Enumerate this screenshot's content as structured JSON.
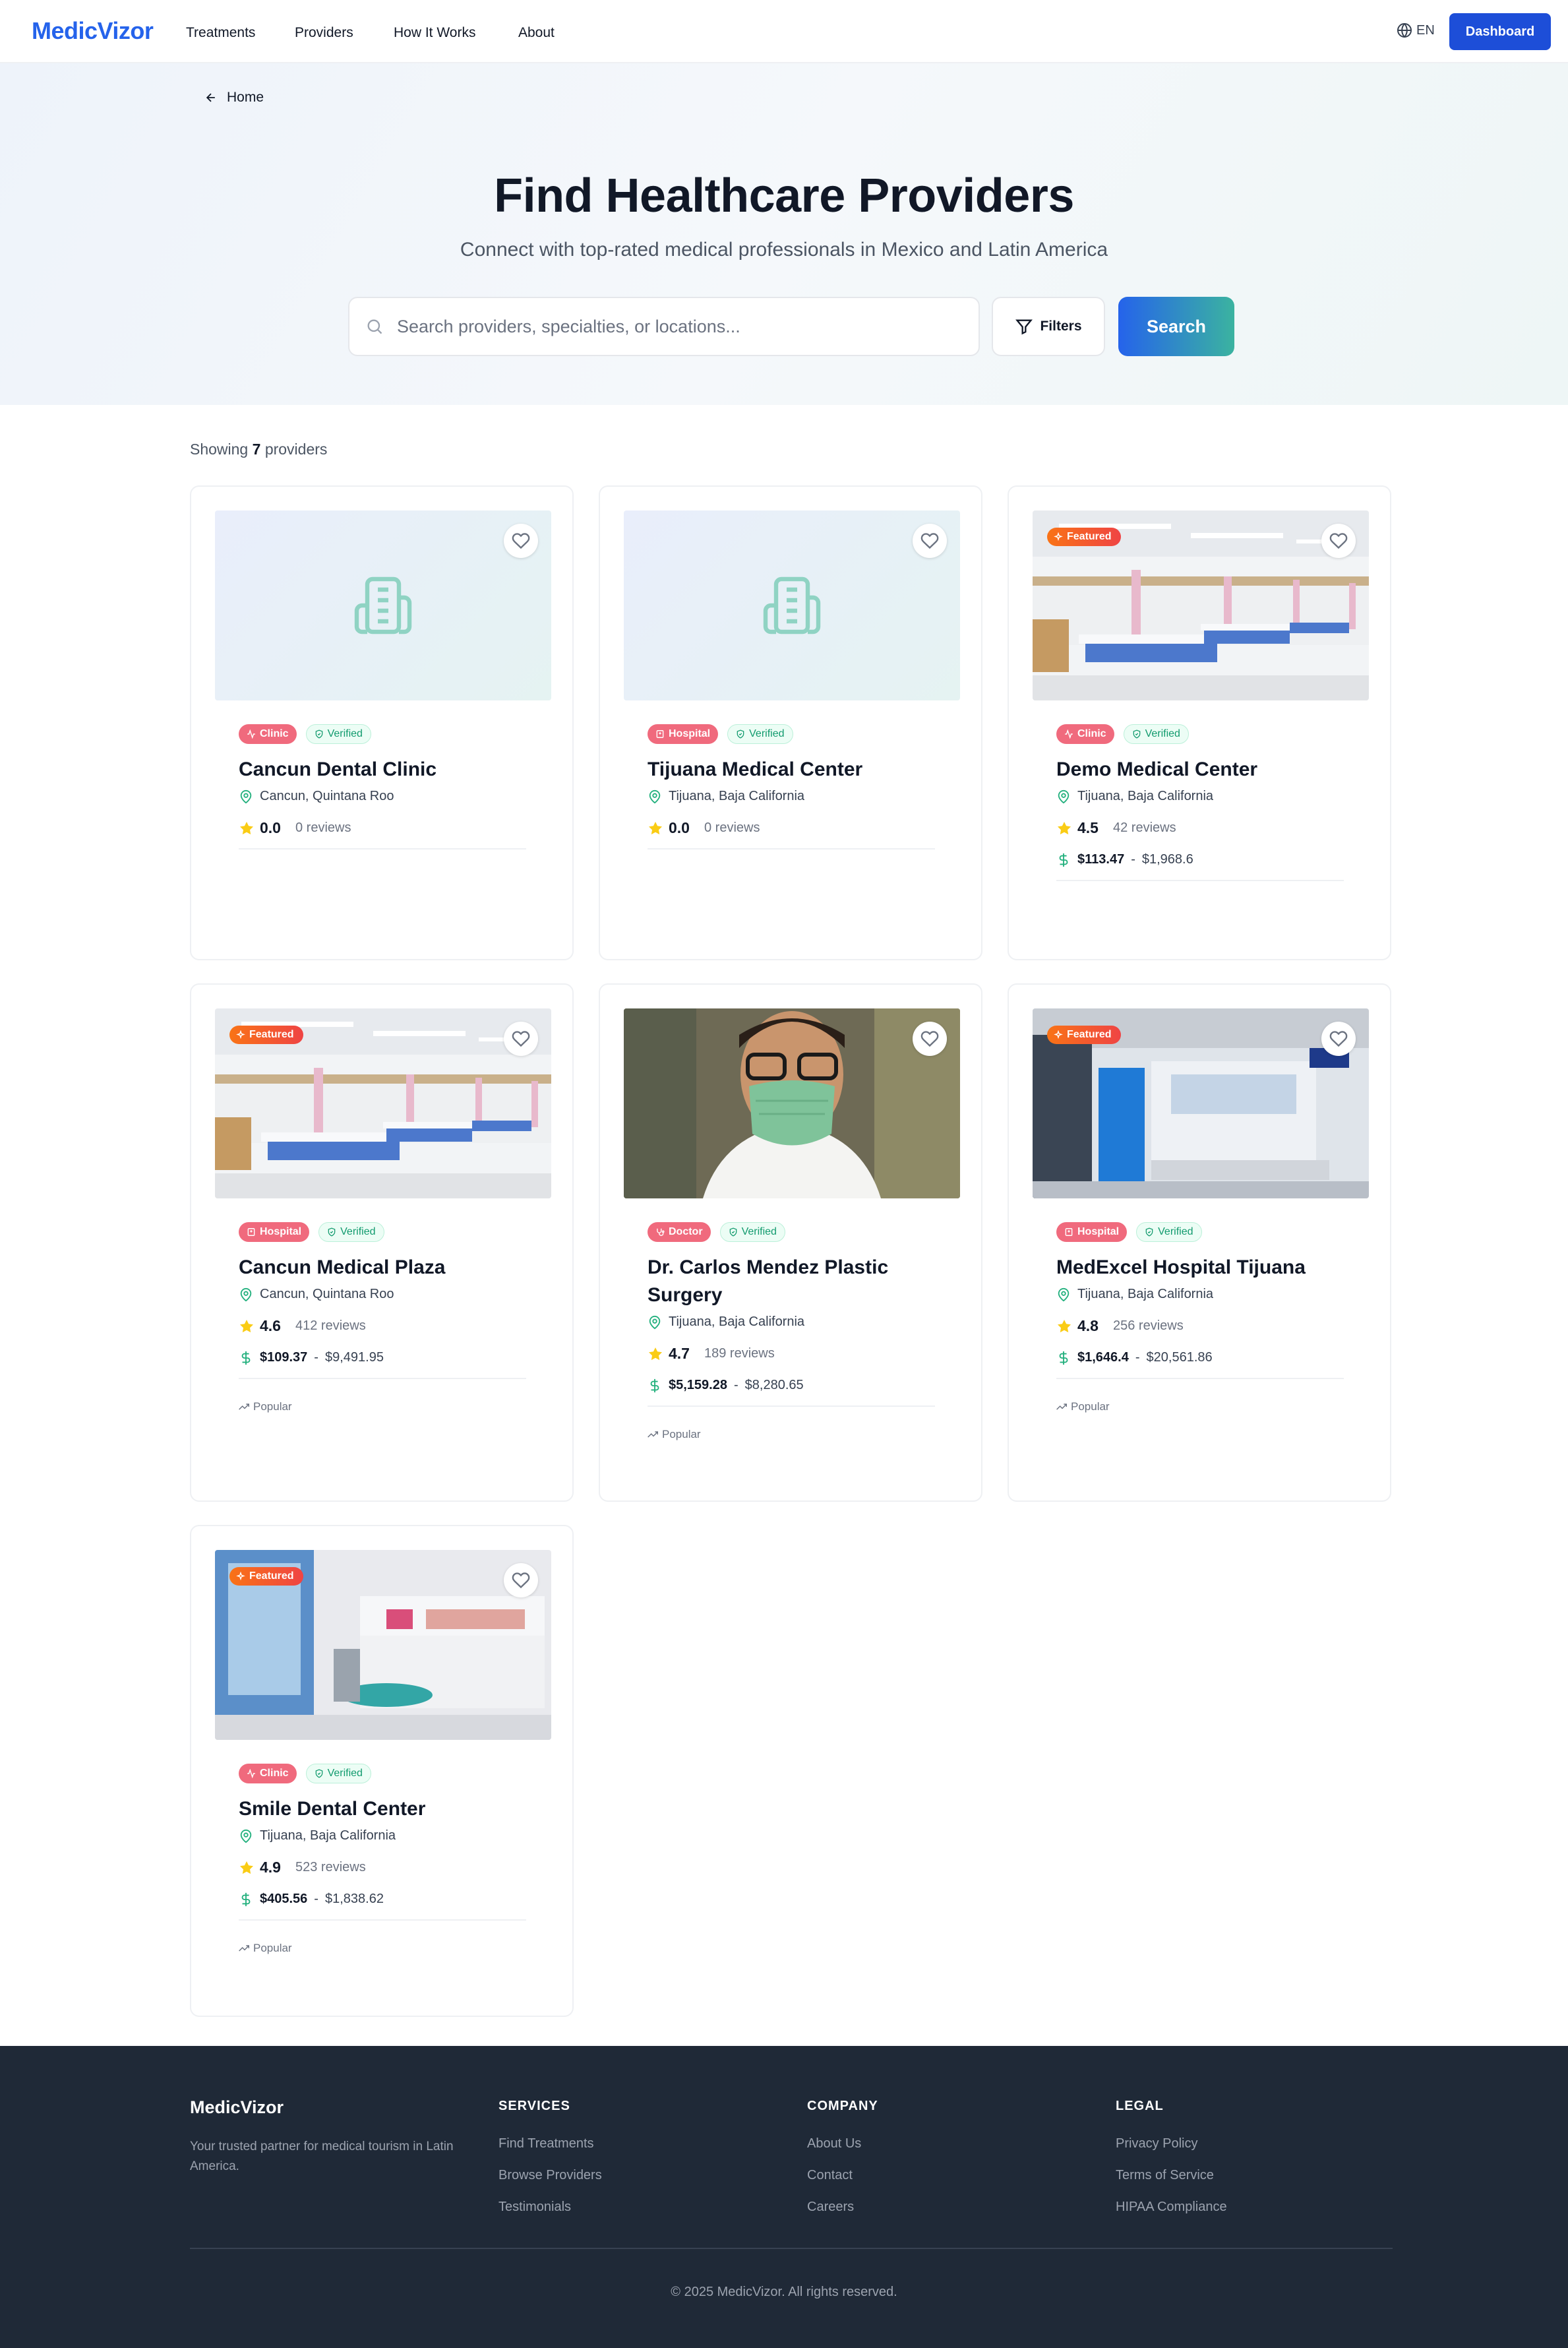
{
  "brand": "MedicVizor",
  "nav": {
    "links": [
      "Treatments",
      "Providers",
      "How It Works",
      "About"
    ],
    "lang": "EN",
    "dashboard": "Dashboard"
  },
  "hero": {
    "back": "Home",
    "title": "Find Healthcare Providers",
    "subtitle": "Connect with top-rated medical professionals in Mexico and Latin America",
    "search_placeholder": "Search providers, specialties, or locations...",
    "filters": "Filters",
    "search": "Search"
  },
  "results": {
    "prefix": "Showing",
    "count": "7",
    "suffix": "providers"
  },
  "labels": {
    "featured": "Featured",
    "verified": "Verified",
    "popular": "Popular"
  },
  "providers": [
    {
      "type": "Clinic",
      "name": "Cancun Dental Clinic",
      "location": "Cancun, Quintana Roo",
      "rating": "0.0",
      "reviews": "0 reviews",
      "price_min": "",
      "price_max": "",
      "featured": false,
      "popular": false,
      "image": "placeholder"
    },
    {
      "type": "Hospital",
      "name": "Tijuana Medical Center",
      "location": "Tijuana, Baja California",
      "rating": "0.0",
      "reviews": "0 reviews",
      "price_min": "",
      "price_max": "",
      "featured": false,
      "popular": false,
      "image": "placeholder"
    },
    {
      "type": "Clinic",
      "name": "Demo Medical Center",
      "location": "Tijuana, Baja California",
      "rating": "4.5",
      "reviews": "42 reviews",
      "price_min": "$113.47",
      "price_max": "$1,968.6",
      "featured": true,
      "popular": false,
      "image": "ward"
    },
    {
      "type": "Hospital",
      "name": "Cancun Medical Plaza",
      "location": "Cancun, Quintana Roo",
      "rating": "4.6",
      "reviews": "412 reviews",
      "price_min": "$109.37",
      "price_max": "$9,491.95",
      "featured": true,
      "popular": true,
      "image": "ward"
    },
    {
      "type": "Doctor",
      "name": "Dr. Carlos Mendez Plastic Surgery",
      "location": "Tijuana, Baja California",
      "rating": "4.7",
      "reviews": "189 reviews",
      "price_min": "$5,159.28",
      "price_max": "$8,280.65",
      "featured": false,
      "popular": true,
      "image": "doctor"
    },
    {
      "type": "Hospital",
      "name": "MedExcel Hospital Tijuana",
      "location": "Tijuana, Baja California",
      "rating": "4.8",
      "reviews": "256 reviews",
      "price_min": "$1,646.4",
      "price_max": "$20,561.86",
      "featured": true,
      "popular": true,
      "image": "lobby"
    },
    {
      "type": "Clinic",
      "name": "Smile Dental Center",
      "location": "Tijuana, Baja California",
      "rating": "4.9",
      "reviews": "523 reviews",
      "price_min": "$405.56",
      "price_max": "$1,838.62",
      "featured": true,
      "popular": true,
      "image": "dental"
    }
  ],
  "footer": {
    "brand": "MedicVizor",
    "tagline": "Your trusted partner for medical tourism in Latin America.",
    "columns": [
      {
        "title": "SERVICES",
        "links": [
          "Find Treatments",
          "Browse Providers",
          "Testimonials"
        ]
      },
      {
        "title": "COMPANY",
        "links": [
          "About Us",
          "Contact",
          "Careers"
        ]
      },
      {
        "title": "LEGAL",
        "links": [
          "Privacy Policy",
          "Terms of Service",
          "HIPAA Compliance"
        ]
      }
    ],
    "copyright": "© 2025 MedicVizor. All rights reserved."
  },
  "colors": {
    "primary": "#2563eb",
    "accent_teal": "#3bb3a0",
    "badge_pink": "#f06a7d",
    "featured_orange": "#f97316",
    "star": "#facc15",
    "footer_bg": "#1f2937"
  }
}
